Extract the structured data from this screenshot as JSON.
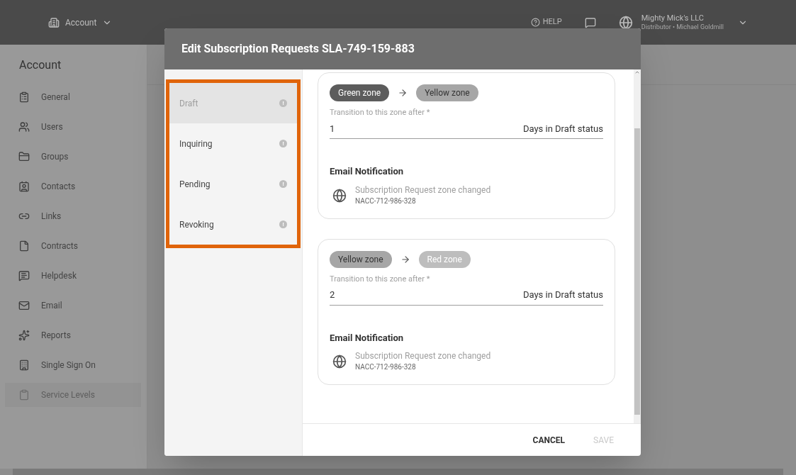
{
  "top_bar": {
    "account_menu": "Account",
    "help": "HELP",
    "org_name": "Mighty Mick's LLC",
    "org_subtitle": "Distributor • Michael Goldmill"
  },
  "sidebar": {
    "title": "Account",
    "items": [
      {
        "label": "General",
        "selected": false
      },
      {
        "label": "Users",
        "selected": false
      },
      {
        "label": "Groups",
        "selected": false
      },
      {
        "label": "Contacts",
        "selected": false
      },
      {
        "label": "Links",
        "selected": false
      },
      {
        "label": "Contracts",
        "selected": false
      },
      {
        "label": "Helpdesk",
        "selected": false
      },
      {
        "label": "Email",
        "selected": false
      },
      {
        "label": "Reports",
        "selected": false
      },
      {
        "label": "Single Sign On",
        "selected": false
      },
      {
        "label": "Service Levels",
        "selected": true
      }
    ]
  },
  "dialog": {
    "title": "Edit Subscription Requests SLA-749-159-883",
    "statuses": [
      {
        "label": "Draft",
        "selected": true,
        "icon": "!"
      },
      {
        "label": "Inquiring",
        "selected": false,
        "icon": "!"
      },
      {
        "label": "Pending",
        "selected": false,
        "icon": "!"
      },
      {
        "label": "Revoking",
        "selected": false,
        "icon": "!"
      }
    ],
    "transitions": [
      {
        "from": {
          "label": "Green zone",
          "color": "#5c5c5c"
        },
        "to": {
          "label": "Yellow zone",
          "color": "#a6a6a6"
        },
        "field_label": "Transition to this zone after *",
        "value": "1",
        "suffix": "Days in Draft status",
        "notification_heading": "Email Notification",
        "notification_title": "Subscription Request zone changed",
        "notification_code": "NACC-712-986-328"
      },
      {
        "from": {
          "label": "Yellow zone",
          "color": "#a6a6a6"
        },
        "to": {
          "label": "Red zone",
          "color": "#bdbdbd"
        },
        "field_label": "Transition to this zone after *",
        "value": "2",
        "suffix": "Days in Draft status",
        "notification_heading": "Email Notification",
        "notification_title": "Subscription Request zone changed",
        "notification_code": "NACC-712-986-328"
      }
    ],
    "buttons": [
      {
        "label": "CANCEL",
        "disabled": false
      },
      {
        "label": "SAVE",
        "disabled": true
      }
    ]
  }
}
